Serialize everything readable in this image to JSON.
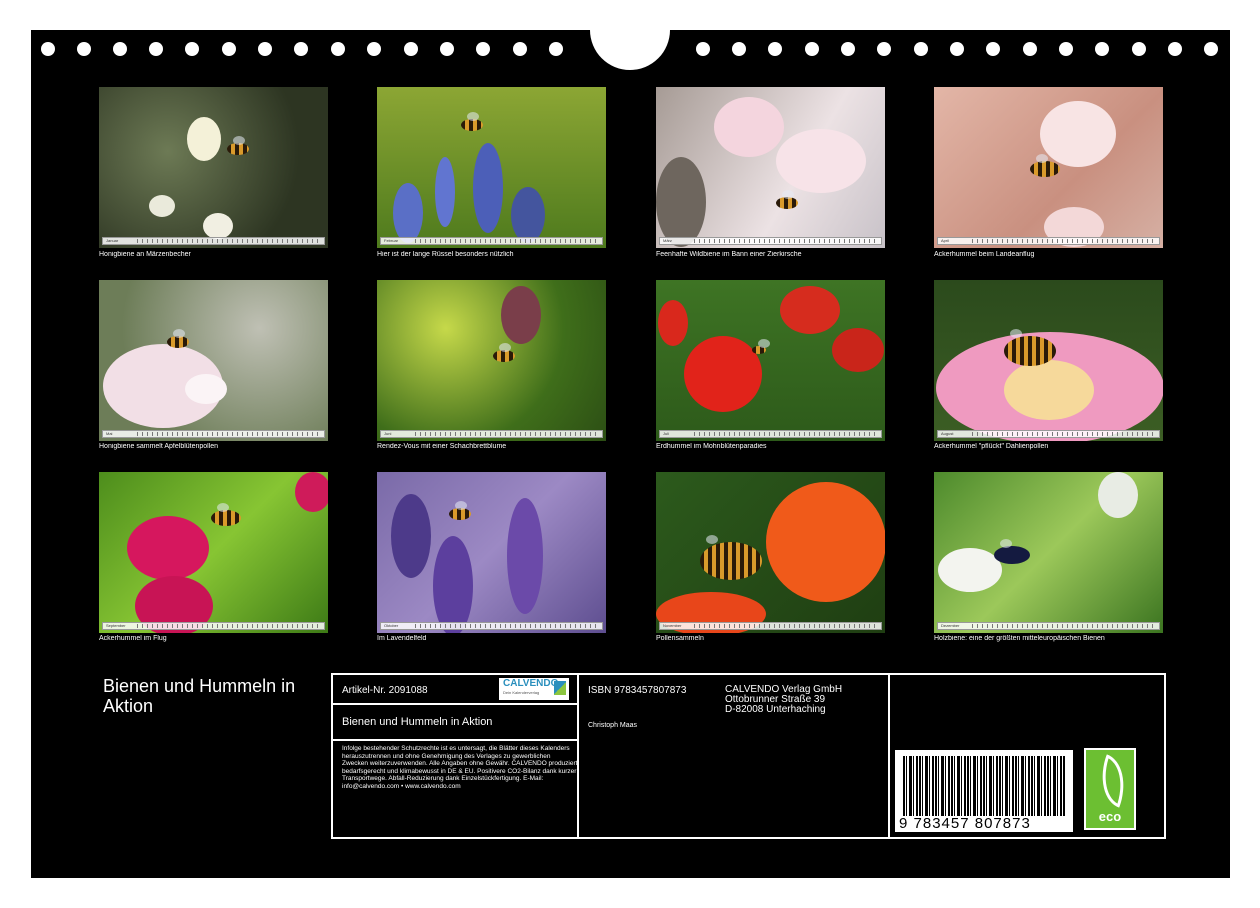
{
  "photos": [
    {
      "caption": "Honigbiene an Märzenbecher",
      "month": "Januar"
    },
    {
      "caption": "Hier ist der lange Rüssel besonders nützlich",
      "month": "Februar"
    },
    {
      "caption": "Feenhafte Wildbiene im Bann einer Zierkirsche",
      "month": "März"
    },
    {
      "caption": "Ackerhummel beim Landeanflug",
      "month": "April"
    },
    {
      "caption": "Honigbiene sammelt Apfelblütenpollen",
      "month": "Mai"
    },
    {
      "caption": "Rendez-Vous mit einer Schachbrettblume",
      "month": "Juni"
    },
    {
      "caption": "Erdhummel im Mohnblütenparadies",
      "month": "Juli"
    },
    {
      "caption": "Ackerhummel \"pflückt\" Dahlienpollen",
      "month": "August"
    },
    {
      "caption": "Ackerhummel im Flug",
      "month": "September"
    },
    {
      "caption": "Im Lavendelfeld",
      "month": "Oktober"
    },
    {
      "caption": "Pollensammeln",
      "month": "November"
    },
    {
      "caption": "Holzbiene: eine der größten mitteleuropäischen Bienen",
      "month": "Dezember"
    }
  ],
  "cover_title": "Bienen und Hummeln in Aktion",
  "imprint": {
    "article_label": "Artikel-Nr. 2091088",
    "logo_text": "CALVENDO",
    "logo_subtext": "Dein Kalenderverlag",
    "title": "Bienen und Hummeln in Aktion",
    "legal_text": "Infolge bestehender Schutzrechte ist es untersagt, die Blätter dieses Kalenders herauszutrennen und ohne Genehmigung des Verlages zu gewerblichen Zwecken weiterzuverwenden. Alle Angaben ohne Gewähr. CALVENDO produziert bedarfsgerecht und klimabewusst in DE & EU. Positivere CO2-Bilanz dank kurzer Transportwege. Abfall-Reduzierung dank Einzelstückfertigung. E-Mail: info@calvendo.com • www.calvendo.com",
    "isbn": "ISBN 9783457807873",
    "author": "Christoph Maas",
    "publisher_name": "CALVENDO Verlag GmbH",
    "publisher_street": "Ottobrunner Straße 39",
    "publisher_city": "D-82008 Unterhaching",
    "barcode_number": "9  783457  807873",
    "eco_label": "eco"
  }
}
